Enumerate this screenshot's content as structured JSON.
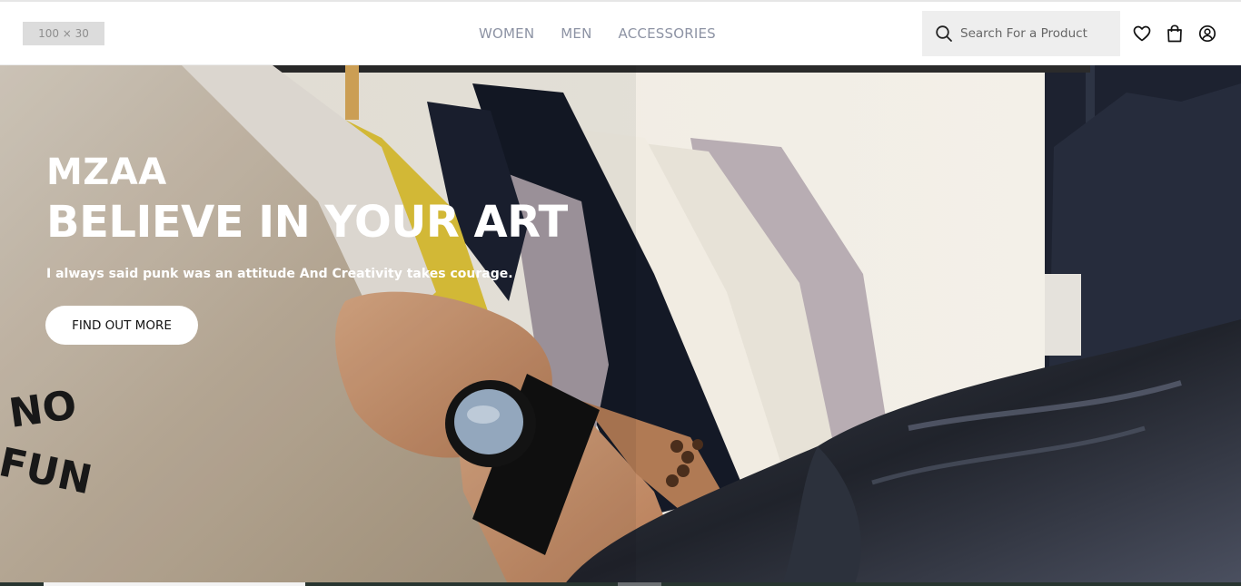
{
  "header": {
    "logo_placeholder": "100 × 30",
    "nav": [
      "WOMEN",
      "MEN",
      "ACCESSORIES"
    ],
    "search_placeholder": "Search For a Product",
    "icons": [
      "search-icon",
      "heart-icon",
      "bag-icon",
      "user-icon"
    ]
  },
  "hero": {
    "brand": "MZAA",
    "headline": "BELIEVE IN YOUR ART",
    "subtitle": "I always said punk was an attitude And Creativity takes courage.",
    "cta_label": "FIND OUT MORE",
    "shirt_print": "NO FUN"
  },
  "colors": {
    "nav_text": "#8d93a4",
    "search_bg": "#eeeeee",
    "hero_text": "#ffffff",
    "cta_bg": "#ffffff"
  }
}
